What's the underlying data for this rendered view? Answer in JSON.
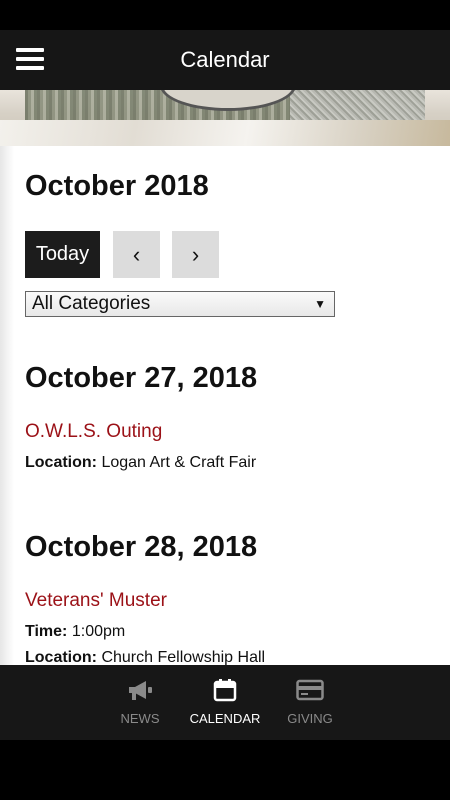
{
  "header": {
    "title": "Calendar",
    "menu_icon": "hamburger-menu-icon"
  },
  "calendar": {
    "month_label": "October 2018",
    "today_label": "Today",
    "prev_label": "‹",
    "next_label": "›",
    "category_value": "All Categories"
  },
  "days": [
    {
      "date": "October 27, 2018",
      "events": [
        {
          "title": "O.W.L.S. Outing",
          "location_label": "Location:",
          "location": "Logan Art & Craft Fair"
        }
      ]
    },
    {
      "date": "October 28, 2018",
      "events": [
        {
          "title": "Veterans' Muster",
          "time_label": "Time:",
          "time": "1:00pm",
          "location_label": "Location:",
          "location": "Church Fellowship Hall"
        }
      ]
    }
  ],
  "tabs": [
    {
      "label": "NEWS",
      "icon": "megaphone-icon",
      "active": false
    },
    {
      "label": "CALENDAR",
      "icon": "calendar-icon",
      "active": true
    },
    {
      "label": "GIVING",
      "icon": "credit-card-icon",
      "active": false
    }
  ],
  "colors": {
    "accent_red": "#9b1117",
    "bar_dark": "#171717"
  }
}
